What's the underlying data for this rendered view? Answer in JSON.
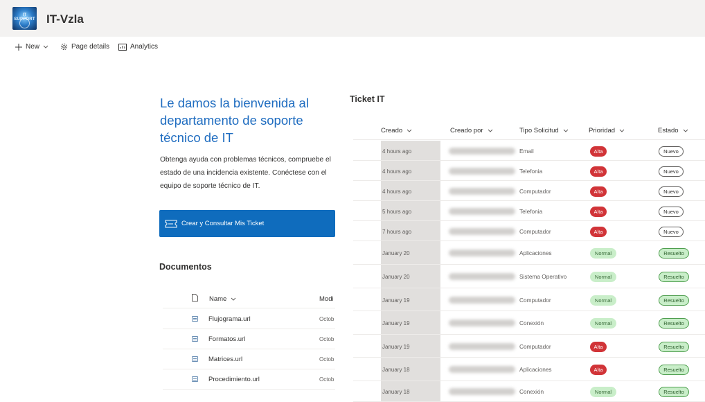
{
  "site": {
    "title": "IT-Vzla",
    "logo_text": "IT SUPPORT"
  },
  "commands": {
    "new": "New",
    "page_details": "Page details",
    "analytics": "Analytics"
  },
  "welcome": {
    "title": "Le damos la bienvenida al departamento de soporte técnico de IT",
    "body": "Obtenga ayuda con problemas técnicos, compruebe el estado de una incidencia existente. Conéctese con el equipo de soporte técnico de IT.",
    "cta": "Crear y Consultar Mis Ticket"
  },
  "documents": {
    "title": "Documentos",
    "columns": {
      "name": "Name",
      "modified": "Modi"
    },
    "items": [
      {
        "name": "Flujograma.url",
        "modified": "Octob"
      },
      {
        "name": "Formatos.url",
        "modified": "Octob"
      },
      {
        "name": "Matrices.url",
        "modified": "Octob"
      },
      {
        "name": "Procedimiento.url",
        "modified": "Octob"
      }
    ]
  },
  "tickets": {
    "title": "Ticket IT",
    "columns": {
      "creado": "Creado",
      "creado_por": "Creado por",
      "tipo": "Tipo Solicitud",
      "prioridad": "Prioridad",
      "estado": "Estado"
    },
    "rows": [
      {
        "creado": "4 hours ago",
        "tipo": "Email",
        "prioridad": "Alta",
        "estado": "Nuevo"
      },
      {
        "creado": "4 hours ago",
        "tipo": "Telefonia",
        "prioridad": "Alta",
        "estado": "Nuevo"
      },
      {
        "creado": "4 hours ago",
        "tipo": "Computador",
        "prioridad": "Alta",
        "estado": "Nuevo"
      },
      {
        "creado": "5 hours ago",
        "tipo": "Telefonia",
        "prioridad": "Alta",
        "estado": "Nuevo"
      },
      {
        "creado": "7 hours ago",
        "tipo": "Computador",
        "prioridad": "Alta",
        "estado": "Nuevo"
      },
      {
        "creado": "January 20",
        "tipo": "Aplicaciones",
        "prioridad": "Normal",
        "estado": "Resuelto"
      },
      {
        "creado": "January 20",
        "tipo": "Sistema Operativo",
        "prioridad": "Normal",
        "estado": "Resuelto"
      },
      {
        "creado": "January 19",
        "tipo": "Computador",
        "prioridad": "Normal",
        "estado": "Resuelto"
      },
      {
        "creado": "January 19",
        "tipo": "Conexión",
        "prioridad": "Normal",
        "estado": "Resuelto"
      },
      {
        "creado": "January 19",
        "tipo": "Computador",
        "prioridad": "Alta",
        "estado": "Resuelto"
      },
      {
        "creado": "January 18",
        "tipo": "Aplicaciones",
        "prioridad": "Alta",
        "estado": "Resuelto"
      },
      {
        "creado": "January 18",
        "tipo": "Conexión",
        "prioridad": "Normal",
        "estado": "Resuelto"
      }
    ]
  },
  "colors": {
    "accent": "#0f6cbd",
    "title_blue": "#1e6cc0",
    "alta": "#d13438",
    "normal_bg": "#c9eec9",
    "header_bg": "#f3f2f1"
  }
}
